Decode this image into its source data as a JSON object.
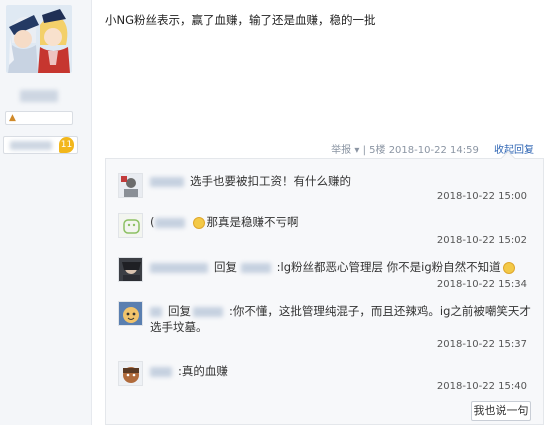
{
  "post": {
    "content": "小NG粉丝表示，赢了血赚，输了还是血赚，稳的一批",
    "meta": {
      "report_label": "举报",
      "report_caret": "▾",
      "separator": "|",
      "floor": "5楼",
      "timestamp": "2018-10-22 14:59",
      "reply_toggle": "收起回复"
    }
  },
  "author": {
    "badge_count": "11",
    "level_icon": "crown-icon"
  },
  "replies": [
    {
      "text": "选手也要被扣工资！有什么赚的",
      "timestamp": "2018-10-22 15:00"
    },
    {
      "prefix": "(",
      "text": "那真是稳赚不亏啊",
      "timestamp": "2018-10-22 15:02"
    },
    {
      "reply_label": "回复",
      "text_part1": ":lg粉丝都恶心管理层 你不是ig粉自然不知道",
      "timestamp": "2018-10-22 15:34"
    },
    {
      "reply_label": "回复",
      "text_line1": ":你不懂，这批管理纯混子，而且还辣鸡。ig之前被嘲笑天才",
      "text_line2": "选手坟墓。",
      "timestamp": "2018-10-22 15:37"
    },
    {
      "text": ":真的血赚",
      "timestamp": "2018-10-22 15:40"
    }
  ],
  "reply_button_label": "我也说一句",
  "colors": {
    "link_blue": "#2d64b3",
    "meta_gray": "#8b95a3",
    "panel_bg": "#f7f8fa",
    "badge_yellow": "#f2b71c"
  }
}
